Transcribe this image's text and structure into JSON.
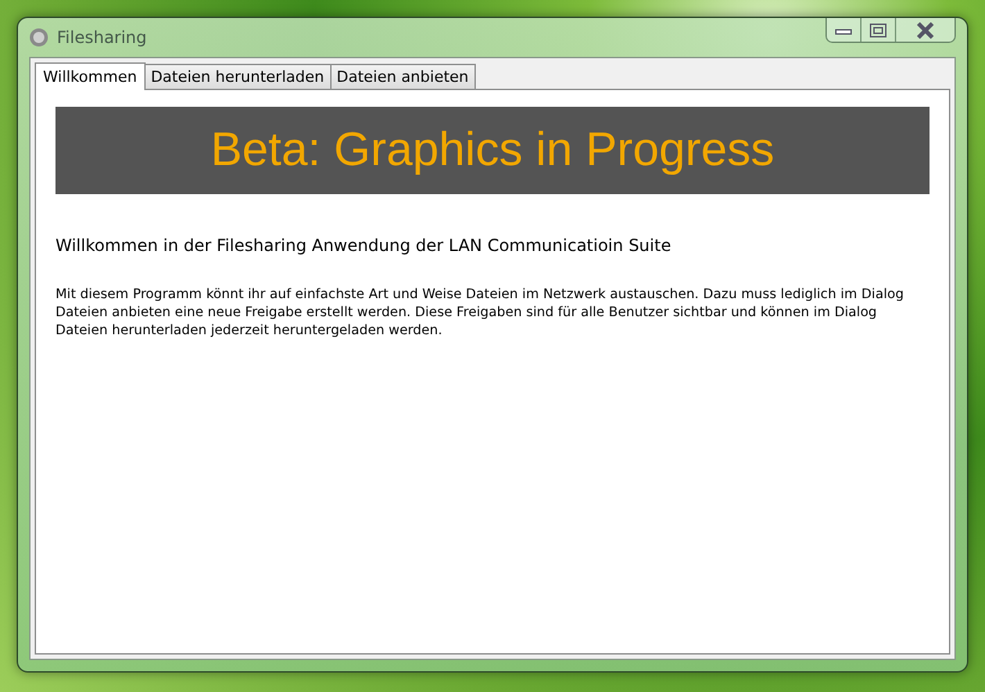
{
  "window": {
    "title": "Filesharing"
  },
  "tabs": [
    {
      "label": "Willkommen",
      "selected": true
    },
    {
      "label": "Dateien herunterladen",
      "selected": false
    },
    {
      "label": "Dateien anbieten",
      "selected": false
    }
  ],
  "banner": {
    "text": "Beta: Graphics in Progress"
  },
  "heading": "Willkommen in der Filesharing Anwendung der LAN Communicatioin Suite",
  "description": "Mit diesem Programm könnt ihr auf einfachste Art und Weise Dateien im Netzwerk austauschen. Dazu muss lediglich im Dialog Dateien anbieten eine neue Freigabe erstellt werden. Diese Freigaben sind für alle Benutzer sichtbar und können im Dialog Dateien herunterladen jederzeit heruntergeladen werden."
}
